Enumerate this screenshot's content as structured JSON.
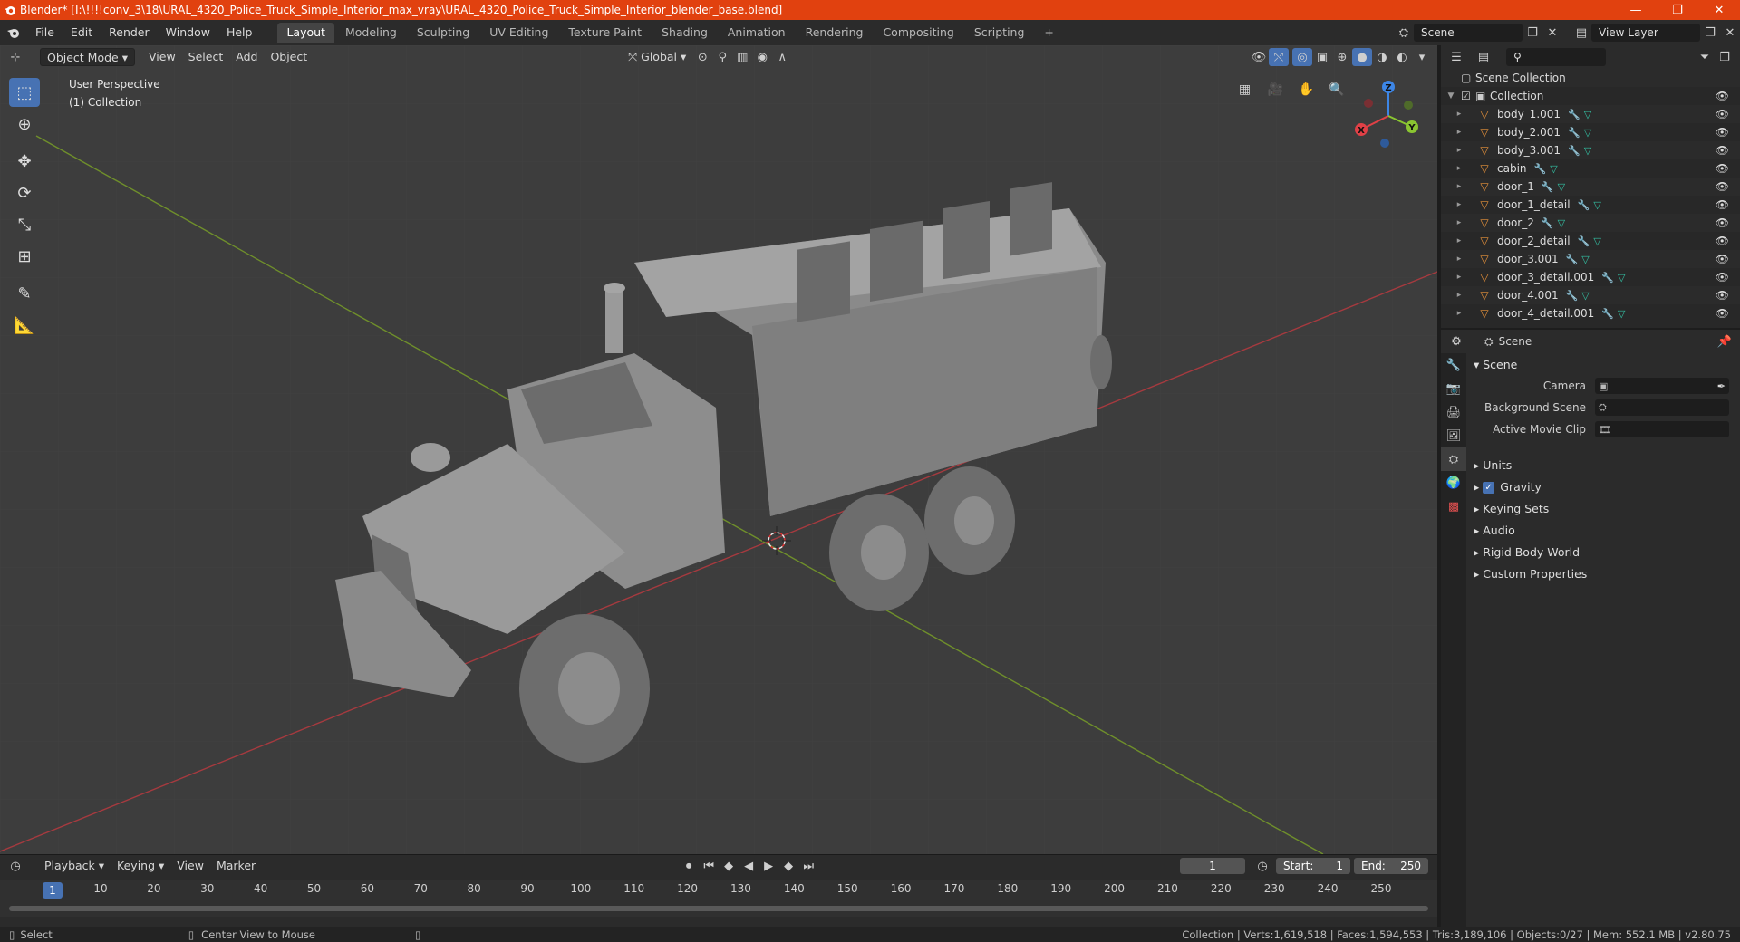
{
  "titlebar": {
    "title": "Blender* [I:\\!!!!conv_3\\18\\URAL_4320_Police_Truck_Simple_Interior_max_vray\\URAL_4320_Police_Truck_Simple_Interior_blender_base.blend]",
    "minimize": "—",
    "maximize": "❐",
    "close": "✕"
  },
  "menu": [
    "File",
    "Edit",
    "Render",
    "Window",
    "Help"
  ],
  "workspaces": [
    "Layout",
    "Modeling",
    "Sculpting",
    "UV Editing",
    "Texture Paint",
    "Shading",
    "Animation",
    "Rendering",
    "Compositing",
    "Scripting"
  ],
  "workspace_add": "+",
  "scene_field": "Scene",
  "view_layer_field": "View Layer",
  "viewport": {
    "mode": "Object Mode",
    "menus": [
      "View",
      "Select",
      "Add",
      "Object"
    ],
    "transform_orientation": "Global",
    "perspective_label": "User Perspective",
    "collection_label": "(1) Collection",
    "gizmo": {
      "x": "X",
      "y": "Y",
      "z": "Z"
    }
  },
  "timeline": {
    "menus": [
      "Playback",
      "Keying",
      "View",
      "Marker"
    ],
    "current_frame": "1",
    "start_label": "Start:",
    "start_value": "1",
    "end_label": "End:",
    "end_value": "250",
    "ticks": [
      "1",
      "10",
      "20",
      "30",
      "40",
      "50",
      "60",
      "70",
      "80",
      "90",
      "100",
      "110",
      "120",
      "130",
      "140",
      "150",
      "160",
      "170",
      "180",
      "190",
      "200",
      "210",
      "220",
      "230",
      "240",
      "250"
    ]
  },
  "statusbar": {
    "left_action": "Select",
    "middle_action": "Center View to Mouse",
    "stats": "Collection | Verts:1,619,518 | Faces:1,594,553 | Tris:3,189,106 | Objects:0/27 | Mem: 552.1 MB | v2.80.75"
  },
  "outliner": {
    "scene_collection": "Scene Collection",
    "collection": "Collection",
    "items": [
      "body_1.001",
      "body_2.001",
      "body_3.001",
      "cabin",
      "door_1",
      "door_1_detail",
      "door_2",
      "door_2_detail",
      "door_3.001",
      "door_3_detail.001",
      "door_4.001",
      "door_4_detail.001"
    ]
  },
  "properties": {
    "header": "Scene",
    "panel_title": "Scene",
    "camera_label": "Camera",
    "background_scene_label": "Background Scene",
    "active_movie_clip_label": "Active Movie Clip",
    "subpanels": [
      "Units",
      "Gravity",
      "Keying Sets",
      "Audio",
      "Rigid Body World",
      "Custom Properties"
    ]
  },
  "colors": {
    "accent": "#4772b3",
    "titlebar": "#e1410f",
    "x_axis": "#e14046",
    "y_axis": "#8ac531",
    "z_axis": "#3d86e6"
  }
}
